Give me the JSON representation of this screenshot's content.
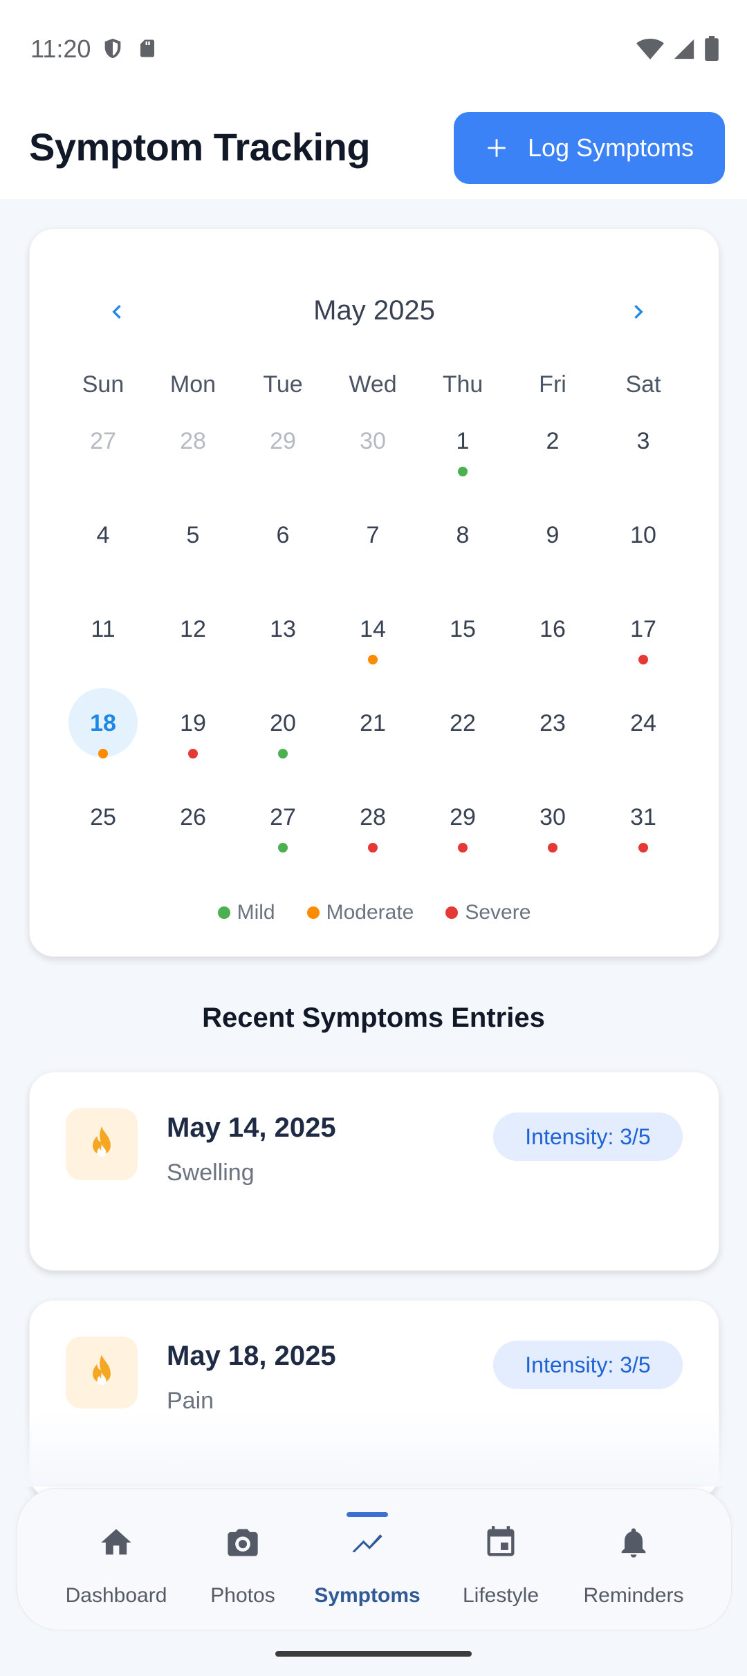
{
  "status_bar": {
    "time": "11:20"
  },
  "header": {
    "title": "Symptom Tracking",
    "log_button_label": "Log Symptoms"
  },
  "calendar": {
    "month_label": "May 2025",
    "weekdays": [
      "Sun",
      "Mon",
      "Tue",
      "Wed",
      "Thu",
      "Fri",
      "Sat"
    ],
    "days": [
      {
        "n": "27",
        "muted": true
      },
      {
        "n": "28",
        "muted": true
      },
      {
        "n": "29",
        "muted": true
      },
      {
        "n": "30",
        "muted": true
      },
      {
        "n": "1",
        "dot": "mild"
      },
      {
        "n": "2"
      },
      {
        "n": "3"
      },
      {
        "n": "4"
      },
      {
        "n": "5"
      },
      {
        "n": "6"
      },
      {
        "n": "7"
      },
      {
        "n": "8"
      },
      {
        "n": "9"
      },
      {
        "n": "10"
      },
      {
        "n": "11"
      },
      {
        "n": "12"
      },
      {
        "n": "13"
      },
      {
        "n": "14",
        "dot": "moderate"
      },
      {
        "n": "15"
      },
      {
        "n": "16"
      },
      {
        "n": "17",
        "dot": "severe"
      },
      {
        "n": "18",
        "dot": "moderate",
        "selected": true
      },
      {
        "n": "19",
        "dot": "severe"
      },
      {
        "n": "20",
        "dot": "mild"
      },
      {
        "n": "21"
      },
      {
        "n": "22"
      },
      {
        "n": "23"
      },
      {
        "n": "24"
      },
      {
        "n": "25"
      },
      {
        "n": "26"
      },
      {
        "n": "27",
        "dot": "mild"
      },
      {
        "n": "28",
        "dot": "severe"
      },
      {
        "n": "29",
        "dot": "severe"
      },
      {
        "n": "30",
        "dot": "severe"
      },
      {
        "n": "31",
        "dot": "severe"
      }
    ],
    "legend": [
      {
        "key": "mild",
        "label": "Mild",
        "color": "#4caf50"
      },
      {
        "key": "moderate",
        "label": "Moderate",
        "color": "#fb8c00"
      },
      {
        "key": "severe",
        "label": "Severe",
        "color": "#e53935"
      }
    ]
  },
  "recent": {
    "title": "Recent Symptoms Entries",
    "entries": [
      {
        "date": "May 14, 2025",
        "symptom": "Swelling",
        "intensity": "Intensity: 3/5",
        "icon": "flame-icon"
      },
      {
        "date": "May 18, 2025",
        "symptom": "Pain",
        "intensity": "Intensity: 3/5",
        "icon": "flame-icon"
      }
    ]
  },
  "bottom_nav": {
    "items": [
      {
        "label": "Dashboard",
        "icon": "home-icon"
      },
      {
        "label": "Photos",
        "icon": "camera-icon"
      },
      {
        "label": "Symptoms",
        "icon": "trend-icon",
        "active": true
      },
      {
        "label": "Lifestyle",
        "icon": "calendar-icon"
      },
      {
        "label": "Reminders",
        "icon": "bell-icon"
      }
    ]
  },
  "colors": {
    "accent": "#3b82f6",
    "selected_day_bg": "#e3f2fd",
    "badge_bg": "#e3edfd",
    "icon_bg": "#fff3e0",
    "flame": "#f5a623"
  }
}
